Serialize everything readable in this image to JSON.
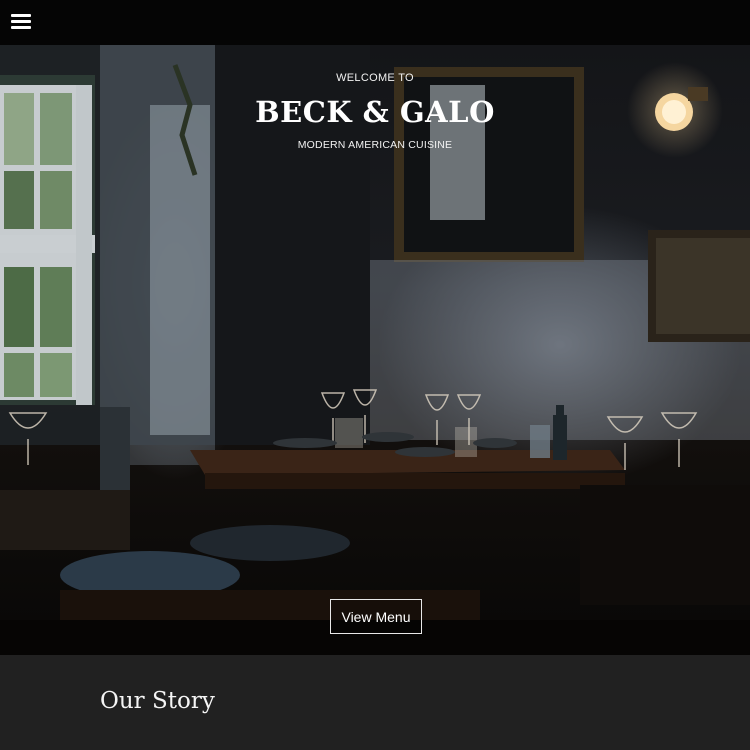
{
  "header": {
    "menu_icon": "hamburger-menu-icon"
  },
  "hero": {
    "welcome": "WELCOME TO",
    "brand": "BECK & GALO",
    "tagline": "MODERN AMERICAN CUISINE",
    "cta_label": "View Menu"
  },
  "story": {
    "title": "Our Story"
  },
  "colors": {
    "topbar": "#050505",
    "story_bg": "#212121",
    "text": "#ffffff"
  }
}
